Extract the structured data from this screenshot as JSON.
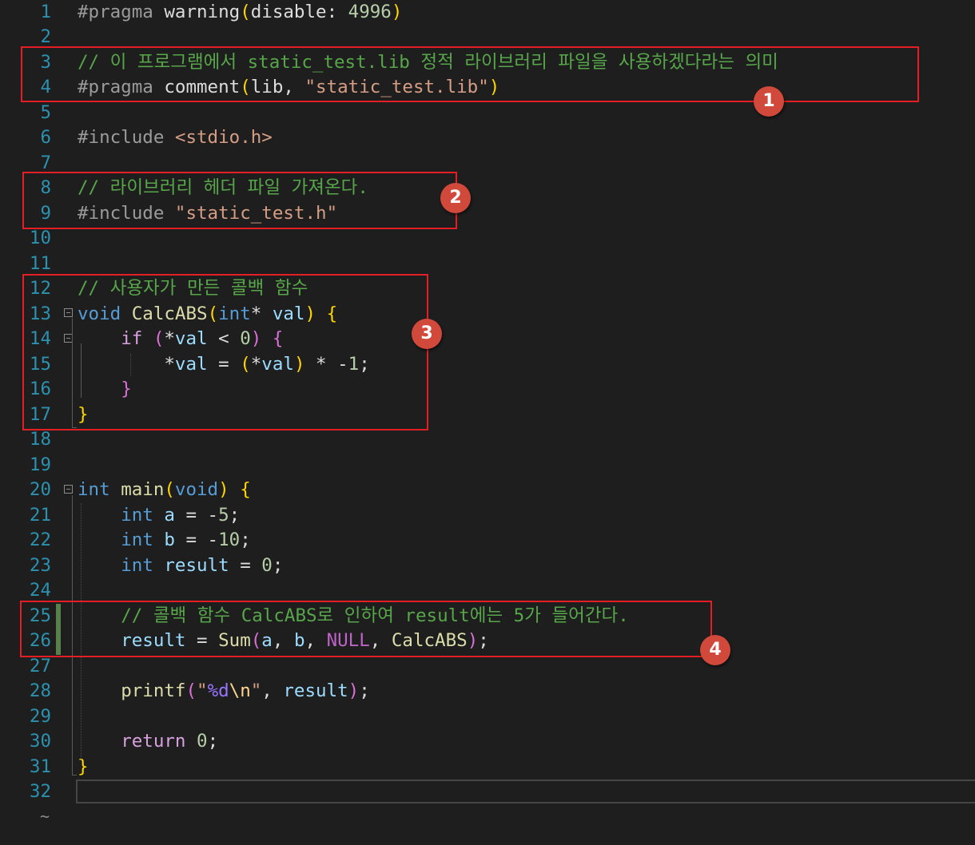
{
  "editor": {
    "language": "C",
    "end_marker": "~"
  },
  "lines": [
    {
      "n": "1",
      "tokens": [
        [
          "pre",
          "#pragma"
        ],
        [
          "plain",
          " warning"
        ],
        [
          "paren",
          "("
        ],
        [
          "plain",
          "disable: "
        ],
        [
          "num",
          "4996"
        ],
        [
          "paren",
          ")"
        ]
      ]
    },
    {
      "n": "2",
      "tokens": []
    },
    {
      "n": "3",
      "tokens": [
        [
          "comment",
          "// 이 프로그램에서 static_test.lib 정적 라이브러리 파일을 사용하겠다라는 의미"
        ]
      ]
    },
    {
      "n": "4",
      "tokens": [
        [
          "pre",
          "#pragma"
        ],
        [
          "plain",
          " comment"
        ],
        [
          "paren",
          "("
        ],
        [
          "plain",
          "lib, "
        ],
        [
          "str",
          "\"static_test.lib\""
        ],
        [
          "paren",
          ")"
        ]
      ]
    },
    {
      "n": "5",
      "tokens": []
    },
    {
      "n": "6",
      "tokens": [
        [
          "pre",
          "#include"
        ],
        [
          "plain",
          " "
        ],
        [
          "str",
          "<stdio.h>"
        ]
      ]
    },
    {
      "n": "7",
      "tokens": []
    },
    {
      "n": "8",
      "tokens": [
        [
          "comment",
          "// 라이브러리 헤더 파일 가져온다."
        ]
      ]
    },
    {
      "n": "9",
      "tokens": [
        [
          "pre",
          "#include"
        ],
        [
          "plain",
          " "
        ],
        [
          "str",
          "\"static_test.h\""
        ]
      ]
    },
    {
      "n": "10",
      "tokens": []
    },
    {
      "n": "11",
      "tokens": []
    },
    {
      "n": "12",
      "tokens": [
        [
          "comment",
          "// 사용자가 만든 콜백 함수"
        ]
      ]
    },
    {
      "n": "13",
      "tokens": [
        [
          "kw",
          "void"
        ],
        [
          "plain",
          " "
        ],
        [
          "func",
          "CalcABS"
        ],
        [
          "paren",
          "("
        ],
        [
          "kw",
          "int"
        ],
        [
          "plain",
          "* "
        ],
        [
          "var",
          "val"
        ],
        [
          "paren",
          ")"
        ],
        [
          "plain",
          " "
        ],
        [
          "paren",
          "{"
        ]
      ]
    },
    {
      "n": "14",
      "tokens": [
        [
          "plain",
          "    "
        ],
        [
          "ctrl",
          "if"
        ],
        [
          "plain",
          " "
        ],
        [
          "paren2",
          "("
        ],
        [
          "plain",
          "*"
        ],
        [
          "var",
          "val"
        ],
        [
          "plain",
          " < "
        ],
        [
          "num",
          "0"
        ],
        [
          "paren2",
          ")"
        ],
        [
          "plain",
          " "
        ],
        [
          "paren2",
          "{"
        ]
      ]
    },
    {
      "n": "15",
      "tokens": [
        [
          "plain",
          "        *"
        ],
        [
          "var",
          "val"
        ],
        [
          "plain",
          " = "
        ],
        [
          "paren",
          "("
        ],
        [
          "plain",
          "*"
        ],
        [
          "var",
          "val"
        ],
        [
          "paren",
          ")"
        ],
        [
          "plain",
          " * -"
        ],
        [
          "num",
          "1"
        ],
        [
          "plain",
          ";"
        ]
      ]
    },
    {
      "n": "16",
      "tokens": [
        [
          "plain",
          "    "
        ],
        [
          "paren2",
          "}"
        ]
      ]
    },
    {
      "n": "17",
      "tokens": [
        [
          "paren",
          "}"
        ]
      ]
    },
    {
      "n": "18",
      "tokens": []
    },
    {
      "n": "19",
      "tokens": []
    },
    {
      "n": "20",
      "tokens": [
        [
          "kw",
          "int"
        ],
        [
          "plain",
          " "
        ],
        [
          "func",
          "main"
        ],
        [
          "paren",
          "("
        ],
        [
          "kw",
          "void"
        ],
        [
          "paren",
          ")"
        ],
        [
          "plain",
          " "
        ],
        [
          "paren",
          "{"
        ]
      ]
    },
    {
      "n": "21",
      "tokens": [
        [
          "plain",
          "    "
        ],
        [
          "kw",
          "int"
        ],
        [
          "plain",
          " "
        ],
        [
          "var",
          "a"
        ],
        [
          "plain",
          " = -"
        ],
        [
          "num",
          "5"
        ],
        [
          "plain",
          ";"
        ]
      ]
    },
    {
      "n": "22",
      "tokens": [
        [
          "plain",
          "    "
        ],
        [
          "kw",
          "int"
        ],
        [
          "plain",
          " "
        ],
        [
          "var",
          "b"
        ],
        [
          "plain",
          " = -"
        ],
        [
          "num",
          "10"
        ],
        [
          "plain",
          ";"
        ]
      ]
    },
    {
      "n": "23",
      "tokens": [
        [
          "plain",
          "    "
        ],
        [
          "kw",
          "int"
        ],
        [
          "plain",
          " "
        ],
        [
          "var",
          "result"
        ],
        [
          "plain",
          " = "
        ],
        [
          "num",
          "0"
        ],
        [
          "plain",
          ";"
        ]
      ]
    },
    {
      "n": "24",
      "tokens": []
    },
    {
      "n": "25",
      "tokens": [
        [
          "plain",
          "    "
        ],
        [
          "comment",
          "// 콜백 함수 CalcABS로 인하여 result에는 5가 들어간다."
        ]
      ]
    },
    {
      "n": "26",
      "tokens": [
        [
          "plain",
          "    "
        ],
        [
          "var",
          "result"
        ],
        [
          "plain",
          " = "
        ],
        [
          "func",
          "Sum"
        ],
        [
          "paren2",
          "("
        ],
        [
          "var",
          "a"
        ],
        [
          "plain",
          ", "
        ],
        [
          "var",
          "b"
        ],
        [
          "plain",
          ", "
        ],
        [
          "macro",
          "NULL"
        ],
        [
          "plain",
          ", "
        ],
        [
          "func",
          "CalcABS"
        ],
        [
          "paren2",
          ")"
        ],
        [
          "plain",
          ";"
        ]
      ]
    },
    {
      "n": "27",
      "tokens": []
    },
    {
      "n": "28",
      "tokens": [
        [
          "plain",
          "    "
        ],
        [
          "func",
          "printf"
        ],
        [
          "paren2",
          "("
        ],
        [
          "str",
          "\""
        ],
        [
          "fmt",
          "%d"
        ],
        [
          "esc",
          "\\n"
        ],
        [
          "str",
          "\""
        ],
        [
          "plain",
          ", "
        ],
        [
          "var",
          "result"
        ],
        [
          "paren2",
          ")"
        ],
        [
          "plain",
          ";"
        ]
      ]
    },
    {
      "n": "29",
      "tokens": []
    },
    {
      "n": "30",
      "tokens": [
        [
          "plain",
          "    "
        ],
        [
          "ctrl",
          "return"
        ],
        [
          "plain",
          " "
        ],
        [
          "num",
          "0"
        ],
        [
          "plain",
          ";"
        ]
      ]
    },
    {
      "n": "31",
      "tokens": [
        [
          "paren",
          "}"
        ]
      ]
    },
    {
      "n": "32",
      "tokens": []
    }
  ],
  "annotations": [
    {
      "label": "1"
    },
    {
      "label": "2"
    },
    {
      "label": "3"
    },
    {
      "label": "4"
    }
  ]
}
